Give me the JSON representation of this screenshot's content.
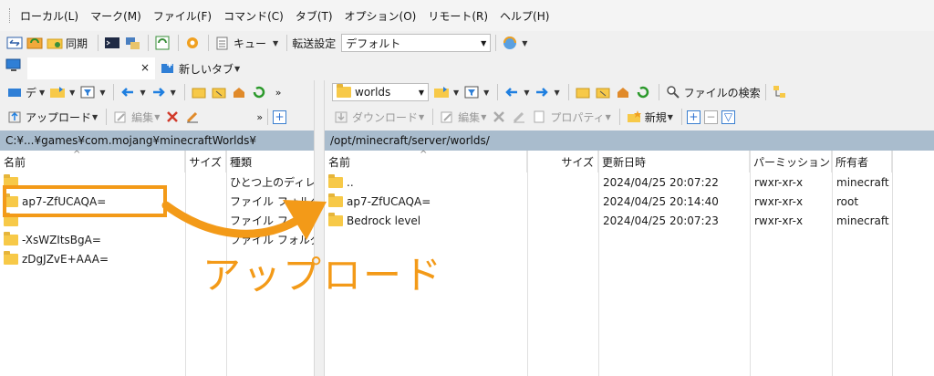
{
  "menu": [
    "ローカル(L)",
    "マーク(M)",
    "ファイル(F)",
    "コマンド(C)",
    "タブ(T)",
    "オプション(O)",
    "リモート(R)",
    "ヘルプ(H)"
  ],
  "toolbar": {
    "sync_label": "同期",
    "queue_label": "キュー",
    "transfer_settings_label": "転送設定",
    "transfer_profile": "デフォルト"
  },
  "tabs": {
    "session_tab_close": "×",
    "new_tab_label": "新しいタブ"
  },
  "local": {
    "drive_label": "デ",
    "upload_label": "アップロード",
    "edit_label": "編集",
    "path": "C:¥...¥games¥com.mojang¥minecraftWorlds¥",
    "columns": [
      "名前",
      "サイズ",
      "種類"
    ],
    "files": [
      {
        "name": "",
        "size": "",
        "type": "ひとつ上のディレクトリ"
      },
      {
        "name": "ap7-ZfUCAQA=",
        "size": "",
        "type": "ファイル フォルダー"
      },
      {
        "name": "",
        "size": "",
        "type": "ファイル フォルダー"
      },
      {
        "name": "-XsWZItsBgA=",
        "size": "",
        "type": "ファイル フォルダー"
      },
      {
        "name": "zDgJZvE+AAA=",
        "size": "",
        "type": ""
      }
    ]
  },
  "remote": {
    "folder_combo": "worlds",
    "find_files_label": "ファイルの検索",
    "download_label": "ダウンロード",
    "edit_label": "編集",
    "properties_label": "プロパティ",
    "new_label": "新規",
    "path": "/opt/minecraft/server/worlds/",
    "columns": [
      "名前",
      "サイズ",
      "更新日時",
      "パーミッション",
      "所有者"
    ],
    "files": [
      {
        "name": "..",
        "size": "",
        "modified": "2024/04/25 20:07:22",
        "permissions": "rwxr-xr-x",
        "owner": "minecraft"
      },
      {
        "name": "ap7-ZfUCAQA=",
        "size": "",
        "modified": "2024/04/25 20:14:40",
        "permissions": "rwxr-xr-x",
        "owner": "root"
      },
      {
        "name": "Bedrock level",
        "size": "",
        "modified": "2024/04/25 20:07:23",
        "permissions": "rwxr-xr-x",
        "owner": "minecraft"
      }
    ]
  },
  "annotation": {
    "label": "アップロード",
    "color": "#f39a18"
  }
}
